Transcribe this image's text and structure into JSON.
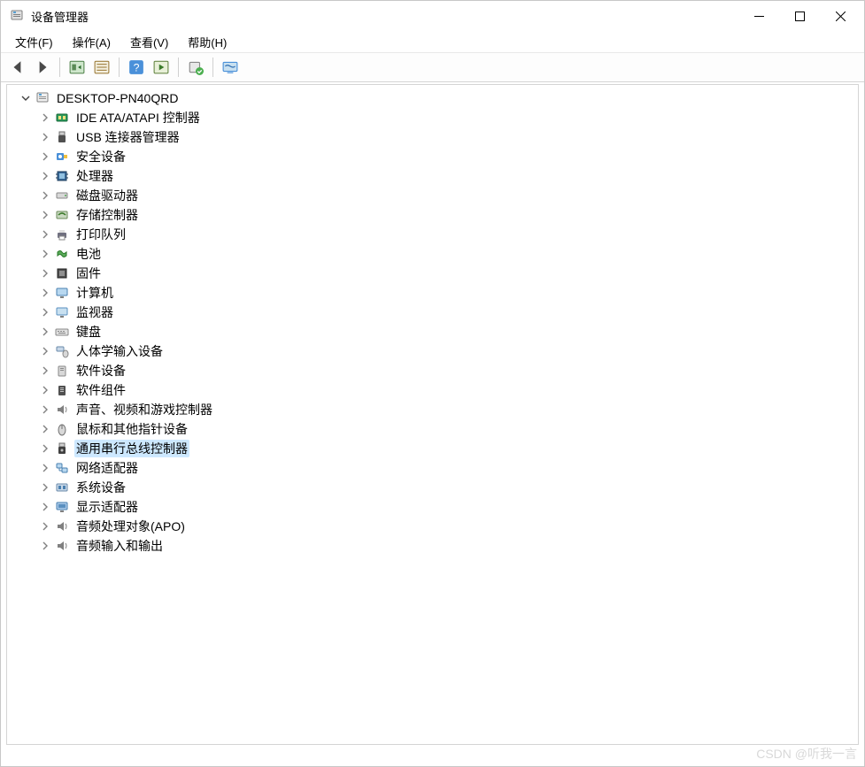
{
  "window": {
    "title": "设备管理器"
  },
  "menubar": {
    "items": [
      {
        "label": "文件(F)"
      },
      {
        "label": "操作(A)"
      },
      {
        "label": "查看(V)"
      },
      {
        "label": "帮助(H)"
      }
    ]
  },
  "toolbar": {
    "buttons": [
      {
        "name": "back",
        "icon": "arrow-left"
      },
      {
        "name": "forward",
        "icon": "arrow-right"
      },
      {
        "name": "sep"
      },
      {
        "name": "show-hide",
        "icon": "panel-toggle"
      },
      {
        "name": "properties",
        "icon": "list-card"
      },
      {
        "name": "sep"
      },
      {
        "name": "help",
        "icon": "help-square"
      },
      {
        "name": "scan",
        "icon": "scan-play"
      },
      {
        "name": "sep"
      },
      {
        "name": "enable",
        "icon": "device-enable"
      },
      {
        "name": "sep"
      },
      {
        "name": "monitor",
        "icon": "monitor-scan"
      }
    ]
  },
  "tree": {
    "root": {
      "label": "DESKTOP-PN40QRD",
      "icon": "computer"
    },
    "children": [
      {
        "label": "IDE ATA/ATAPI 控制器",
        "icon": "ide-card",
        "selected": false
      },
      {
        "label": "USB 连接器管理器",
        "icon": "usb-plug",
        "selected": false
      },
      {
        "label": "安全设备",
        "icon": "security-key",
        "selected": false
      },
      {
        "label": "处理器",
        "icon": "cpu-chip",
        "selected": false
      },
      {
        "label": "磁盘驱动器",
        "icon": "disk-drive",
        "selected": false
      },
      {
        "label": "存储控制器",
        "icon": "storage-ctrl",
        "selected": false
      },
      {
        "label": "打印队列",
        "icon": "printer",
        "selected": false
      },
      {
        "label": "电池",
        "icon": "battery",
        "selected": false
      },
      {
        "label": "固件",
        "icon": "firmware",
        "selected": false
      },
      {
        "label": "计算机",
        "icon": "pc-monitor",
        "selected": false
      },
      {
        "label": "监视器",
        "icon": "monitor",
        "selected": false
      },
      {
        "label": "键盘",
        "icon": "keyboard",
        "selected": false
      },
      {
        "label": "人体学输入设备",
        "icon": "hid",
        "selected": false
      },
      {
        "label": "软件设备",
        "icon": "soft-dev",
        "selected": false
      },
      {
        "label": "软件组件",
        "icon": "soft-comp",
        "selected": false
      },
      {
        "label": "声音、视频和游戏控制器",
        "icon": "speaker",
        "selected": false
      },
      {
        "label": "鼠标和其他指针设备",
        "icon": "mouse",
        "selected": false
      },
      {
        "label": "通用串行总线控制器",
        "icon": "usb-ctrl",
        "selected": true
      },
      {
        "label": "网络适配器",
        "icon": "network",
        "selected": false
      },
      {
        "label": "系统设备",
        "icon": "system-dev",
        "selected": false
      },
      {
        "label": "显示适配器",
        "icon": "display",
        "selected": false
      },
      {
        "label": "音频处理对象(APO)",
        "icon": "speaker",
        "selected": false
      },
      {
        "label": "音频输入和输出",
        "icon": "speaker",
        "selected": false
      }
    ]
  },
  "watermark": "CSDN @听我一言"
}
